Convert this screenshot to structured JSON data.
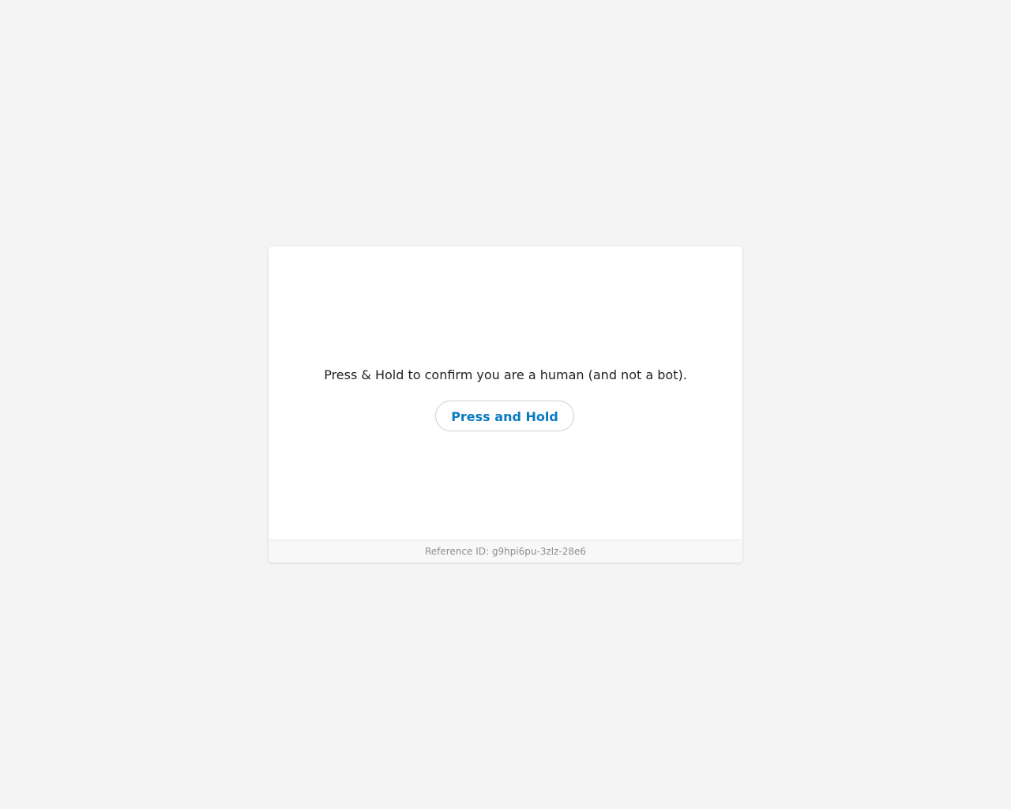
{
  "challenge": {
    "prompt": "Press & Hold to confirm you are a human (and not a bot).",
    "button_label": "Press and Hold"
  },
  "footer": {
    "reference_label": "Reference ID:",
    "reference_id": "g9hpi6pu-3zlz-28e6"
  },
  "colors": {
    "background": "#f4f4f4",
    "button_text": "#0a7ac2"
  }
}
